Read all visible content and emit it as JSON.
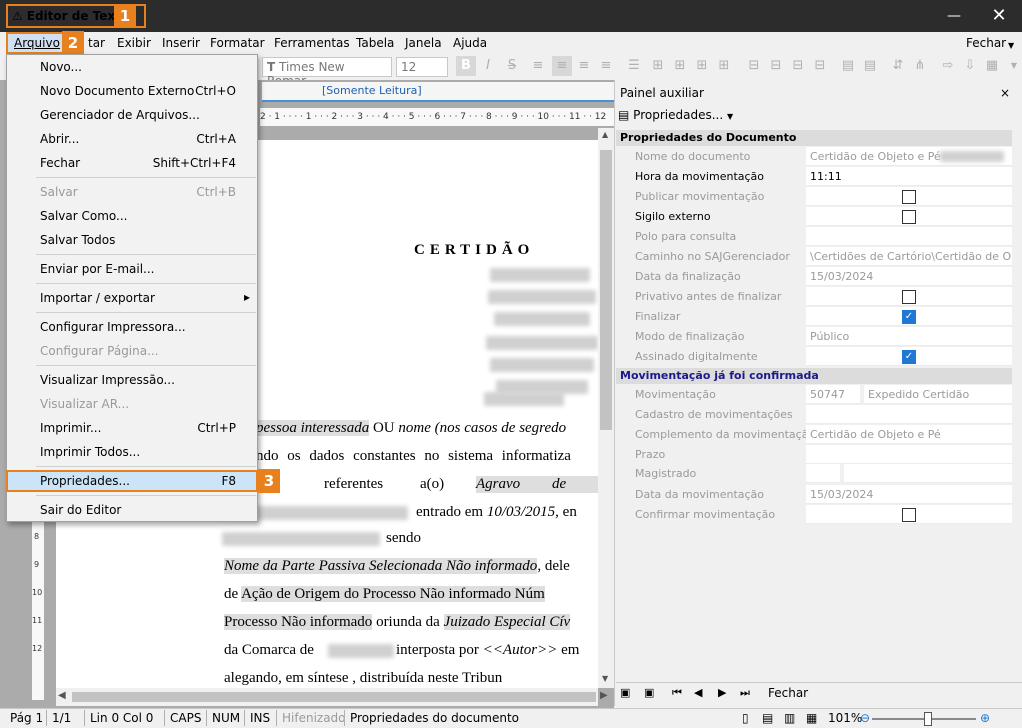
{
  "window": {
    "title": "Editor de Textos",
    "minimize": "—",
    "close": "✕"
  },
  "badges": [
    "1",
    "2",
    "3"
  ],
  "menubar": {
    "items": [
      "Arquivo",
      "Editar",
      "Exibir",
      "Inserir",
      "Formatar",
      "Ferramentas",
      "Tabela",
      "Janela",
      "Ajuda"
    ],
    "visible_partial": "tar",
    "right_button": "Fechar"
  },
  "toolbar": {
    "font_name": "Times New Romar",
    "font_size": "12"
  },
  "document": {
    "tab_label": "[Somente Leitura]",
    "ruler_text": "2 · 1 · · · · 1 · · · 2 · · · 3 · · · 4 · · · 5 · · · 6 · · · 7 · · · 8 · · · 9 · · · 10 · · · 11 · · 12",
    "title": "CERTIDÃO",
    "lines": {
      "l1a": "pessoa interessada",
      "l1b": " OU ",
      "l1c": "nome (nos casos de segredo",
      "l2": "ndo os dados constantes no sistema informatiza",
      "l3a": "al",
      "l3b": "referentes",
      "l3c": "a(o)",
      "l3d": "Agravo",
      "l3e": "de",
      "l4a": "entrado em ",
      "l4b": "10/03/2015",
      "l4c": ", en",
      "l5": "sendo",
      "l6a": "Nome da Parte Passiva Selecionada Não informado",
      "l6b": ", dele",
      "l7a": "de ",
      "l7b": "Ação de Origem do Processo Não informado",
      "l7c": " Núm",
      "l8a": "Processo Não informado",
      "l8b": " oriunda da ",
      "l8c": "Juizado Especial Cív",
      "l9a": "da Comarca de",
      "l9b": "interposta por ",
      "l9c": "<<Autor>>",
      "l9d": " em",
      "l10": "alegando,  em  síntese  ,  distribuída  neste  Tribun"
    }
  },
  "file_menu": {
    "items": [
      {
        "label": "Novo...",
        "shortcut": ""
      },
      {
        "label": "Novo Documento Externo",
        "shortcut": "Ctrl+O"
      },
      {
        "label": "Gerenciador de Arquivos...",
        "shortcut": ""
      },
      {
        "label": "Abrir...",
        "shortcut": "Ctrl+A"
      },
      {
        "label": "Fechar",
        "shortcut": "Shift+Ctrl+F4"
      },
      {
        "label": "Salvar",
        "shortcut": "Ctrl+B"
      },
      {
        "label": "Salvar Como...",
        "shortcut": ""
      },
      {
        "label": "Salvar Todos",
        "shortcut": ""
      },
      {
        "label": "Enviar por E-mail...",
        "shortcut": ""
      },
      {
        "label": "Importar / exportar",
        "shortcut": "▸"
      },
      {
        "label": "Configurar Impressora...",
        "shortcut": ""
      },
      {
        "label": "Configurar Página...",
        "shortcut": ""
      },
      {
        "label": "Visualizar Impressão...",
        "shortcut": ""
      },
      {
        "label": "Visualizar AR...",
        "shortcut": ""
      },
      {
        "label": "Imprimir...",
        "shortcut": "Ctrl+P"
      },
      {
        "label": "Imprimir Todos...",
        "shortcut": ""
      },
      {
        "label": "Propriedades...",
        "shortcut": "F8"
      },
      {
        "label": "Sair do Editor",
        "shortcut": ""
      }
    ]
  },
  "panel": {
    "title": "Painel auxiliar",
    "close": "×",
    "properties_button": "Propriedades...",
    "section1": "Propriedades do Documento",
    "rows1": [
      {
        "label": "Nome do documento",
        "value": "Certidão de Objeto e Pé"
      },
      {
        "label": "Hora da movimentação",
        "value": "11:11"
      },
      {
        "label": "Publicar movimentação",
        "value": ""
      },
      {
        "label": "Sigilo externo",
        "value": ""
      },
      {
        "label": "Polo para consulta",
        "value": ""
      },
      {
        "label": "Caminho no SAJGerenciador",
        "value": "\\Certidões de Cartório\\Certidão de Ob..."
      },
      {
        "label": "Data da finalização",
        "value": "15/03/2024"
      },
      {
        "label": "Privativo antes de finalizar",
        "value": ""
      },
      {
        "label": "Finalizar",
        "value": ""
      },
      {
        "label": "Modo de finalização",
        "value": "Público"
      },
      {
        "label": "Assinado digitalmente",
        "value": ""
      }
    ],
    "section2": "Movimentação já foi confirmada",
    "rows2": [
      {
        "label": "Movimentação",
        "value": "50747",
        "value2": "Expedido Certidão"
      },
      {
        "label": "Cadastro de movimentações",
        "value": ""
      },
      {
        "label": "Complemento da movimentação",
        "value": "Certidão de Objeto e Pé"
      },
      {
        "label": "Prazo",
        "value": ""
      },
      {
        "label": "Magistrado",
        "value": ""
      },
      {
        "label": "Data da movimentação",
        "value": "15/03/2024"
      },
      {
        "label": "Confirmar movimentação",
        "value": ""
      }
    ],
    "footer_close": "Fechar"
  },
  "status": {
    "page": "Pág 1",
    "pages": "1/1",
    "position": "Lin 0  Col 0",
    "caps": "CAPS",
    "num": "NUM",
    "ins": "INS",
    "hyphen": "Hifenizado",
    "message": "Propriedades do documento",
    "zoom": "101%"
  },
  "colors": {
    "accent": "#e8801e",
    "titlebar": "#2c2c2c",
    "checkbox": "#1e78d4"
  }
}
